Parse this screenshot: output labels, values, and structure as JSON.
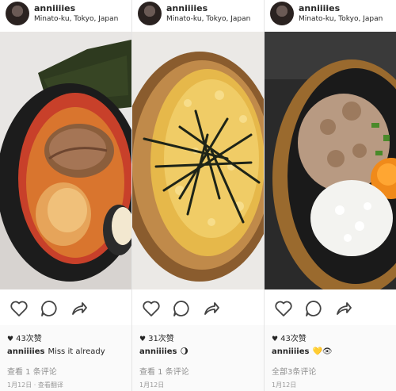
{
  "posts": [
    {
      "username": "anniiiies",
      "location": "Minato-ku, Tokyo, Japan",
      "likes": "43次赞",
      "caption_user": "anniiiies",
      "caption_text": "Miss it already",
      "comments": "查看 1 条评论",
      "date": "1月12日 · 查看翻译",
      "photo": "tonkotsu ramen with chashu, egg and nori in a black bowl"
    },
    {
      "username": "anniiiies",
      "location": "Minato-ku, Tokyo, Japan",
      "likes": "31次赞",
      "caption_user": "anniiiies",
      "caption_text": "🌖",
      "comments": "查看 1 条评论",
      "date": "1月12日",
      "photo": "fried rice topped with shredded nori in a bowl"
    },
    {
      "username": "anniiiies",
      "location": "Minato-ku, Tokyo, Japan",
      "likes": "43次赞",
      "caption_user": "anniiiies",
      "caption_text": "💛👁",
      "comments": "全部3条评论",
      "date": "1月12日",
      "photo": "donburi bowl with rice, minced meat, scallion and egg yolk"
    }
  ],
  "icons": [
    "heart-icon",
    "comment-icon",
    "share-icon"
  ],
  "colors": {
    "text": "#262626",
    "muted": "#8e8e8e",
    "bg": "#fafafa"
  }
}
